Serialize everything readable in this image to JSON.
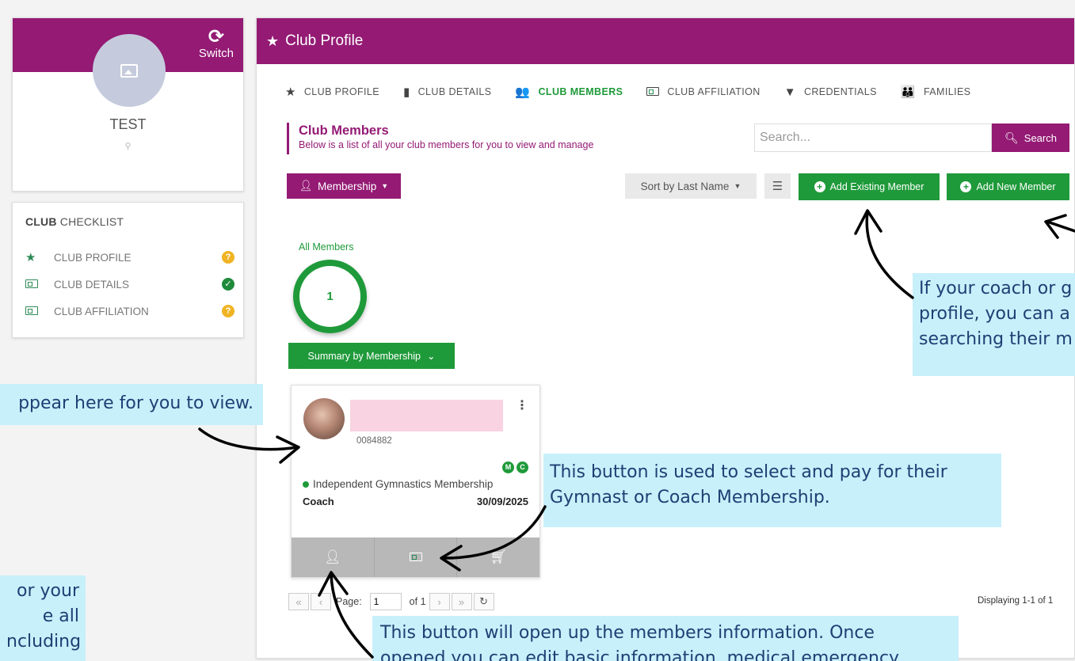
{
  "profile": {
    "switch_label": "Switch",
    "club_name": "TEST"
  },
  "checklist": {
    "title_bold": "CLUB",
    "title_rest": " CHECKLIST",
    "items": [
      {
        "label": "CLUB PROFILE",
        "status": "warn"
      },
      {
        "label": "CLUB DETAILS",
        "status": "ok"
      },
      {
        "label": "CLUB AFFILIATION",
        "status": "warn"
      }
    ]
  },
  "header": {
    "title": "Club Profile"
  },
  "tabs": [
    {
      "label": "CLUB PROFILE",
      "active": false
    },
    {
      "label": "CLUB DETAILS",
      "active": false
    },
    {
      "label": "CLUB MEMBERS",
      "active": true
    },
    {
      "label": "CLUB AFFILIATION",
      "active": false
    },
    {
      "label": "CREDENTIALS",
      "active": false
    },
    {
      "label": "FAMILIES",
      "active": false
    }
  ],
  "section": {
    "title": "Club Members",
    "subtitle": "Below is a list of all your club members for you to view and manage"
  },
  "search": {
    "placeholder": "Search...",
    "value": "",
    "button_label": "Search"
  },
  "toolbar": {
    "membership_label": "Membership",
    "sort_label": "Sort by Last Name",
    "add_existing_label": "Add Existing Member",
    "add_new_label": "Add New Member"
  },
  "summary": {
    "all_members_label": "All Members",
    "all_members_count": "1",
    "summary_button_label": "Summary by Membership"
  },
  "member": {
    "id": "0084882",
    "badges": [
      "M",
      "C"
    ],
    "membership": "Independent Gymnastics Membership",
    "role": "Coach",
    "expiry": "30/09/2025"
  },
  "pager": {
    "page_label": "Page:",
    "page_value": "1",
    "of_label": "of 1",
    "displaying": "Displaying 1-1 of 1"
  },
  "callouts": {
    "add_existing": [
      "If your coach or g",
      "profile, you can a",
      "searching their m"
    ],
    "members_appear": "ppear here for you to view.",
    "membership_button": [
      "This button is used to select and pay for their",
      "Gymnast or Coach Membership."
    ],
    "left_partial": [
      "or your",
      "e all",
      "ncluding"
    ],
    "info_button": [
      "This button will open up the members information. Once",
      "opened you can edit basic information, medical emergency"
    ]
  },
  "colors": {
    "brand_purple": "#941a74",
    "accent_green": "#1f9a3a",
    "callout_bg": "#c7f0fb",
    "callout_text": "#1f3f73"
  }
}
